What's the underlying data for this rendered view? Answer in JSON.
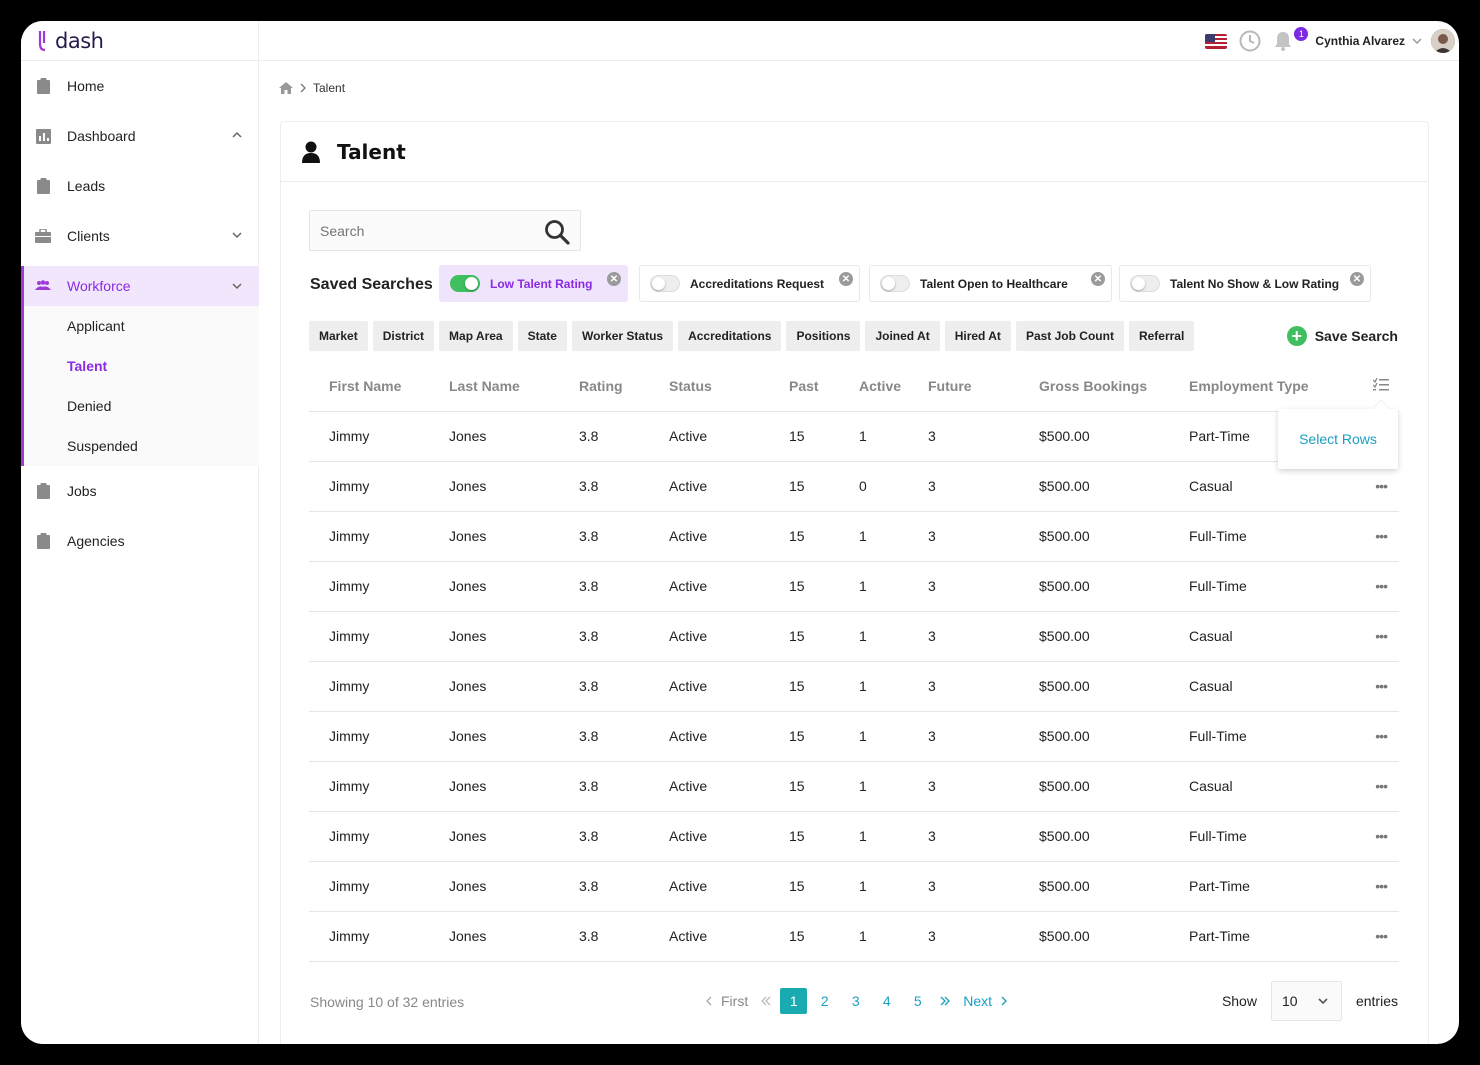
{
  "app": {
    "name": "dash"
  },
  "user": {
    "name": "Cynthia Alvarez",
    "notifications": "1"
  },
  "sidebar": {
    "items": [
      {
        "label": "Home",
        "icon": "clipboard-icon"
      },
      {
        "label": "Dashboard",
        "icon": "chart-icon",
        "expanded": true
      },
      {
        "label": "Leads",
        "icon": "clipboard-icon"
      },
      {
        "label": "Clients",
        "icon": "briefcase-icon",
        "expanded": false
      },
      {
        "label": "Workforce",
        "icon": "users-icon",
        "expanded": true
      },
      {
        "label": "Jobs",
        "icon": "clipboard-icon"
      },
      {
        "label": "Agencies",
        "icon": "clipboard-icon"
      }
    ],
    "workforce_sub": [
      "Applicant",
      "Talent",
      "Denied",
      "Suspended"
    ],
    "active_sub": "Talent"
  },
  "breadcrumb": {
    "current": "Talent"
  },
  "page": {
    "title": "Talent"
  },
  "search": {
    "placeholder": "Search"
  },
  "saved_searches": {
    "label": "Saved Searches",
    "chips": [
      {
        "label": "Low Talent Rating",
        "on": true
      },
      {
        "label": "Accreditations Request",
        "on": false
      },
      {
        "label": "Talent Open to Healthcare",
        "on": false
      },
      {
        "label": "Talent No Show & Low Rating",
        "on": false
      }
    ]
  },
  "filters": [
    "Market",
    "District",
    "Map Area",
    "State",
    "Worker Status",
    "Accreditations",
    "Positions",
    "Joined At",
    "Hired At",
    "Past Job Count",
    "Referral"
  ],
  "save_search_label": "Save Search",
  "table": {
    "columns": [
      "First Name",
      "Last Name",
      "Rating",
      "Status",
      "Past",
      "Active",
      "Future",
      "Gross Bookings",
      "Employment Type"
    ],
    "rows": [
      [
        "Jimmy",
        "Jones",
        "3.8",
        "Active",
        "15",
        "1",
        "3",
        "$500.00",
        "Part-Time"
      ],
      [
        "Jimmy",
        "Jones",
        "3.8",
        "Active",
        "15",
        "0",
        "3",
        "$500.00",
        "Casual"
      ],
      [
        "Jimmy",
        "Jones",
        "3.8",
        "Active",
        "15",
        "1",
        "3",
        "$500.00",
        "Full-Time"
      ],
      [
        "Jimmy",
        "Jones",
        "3.8",
        "Active",
        "15",
        "1",
        "3",
        "$500.00",
        "Full-Time"
      ],
      [
        "Jimmy",
        "Jones",
        "3.8",
        "Active",
        "15",
        "1",
        "3",
        "$500.00",
        "Casual"
      ],
      [
        "Jimmy",
        "Jones",
        "3.8",
        "Active",
        "15",
        "1",
        "3",
        "$500.00",
        "Casual"
      ],
      [
        "Jimmy",
        "Jones",
        "3.8",
        "Active",
        "15",
        "1",
        "3",
        "$500.00",
        "Full-Time"
      ],
      [
        "Jimmy",
        "Jones",
        "3.8",
        "Active",
        "15",
        "1",
        "3",
        "$500.00",
        "Casual"
      ],
      [
        "Jimmy",
        "Jones",
        "3.8",
        "Active",
        "15",
        "1",
        "3",
        "$500.00",
        "Full-Time"
      ],
      [
        "Jimmy",
        "Jones",
        "3.8",
        "Active",
        "15",
        "1",
        "3",
        "$500.00",
        "Part-Time"
      ],
      [
        "Jimmy",
        "Jones",
        "3.8",
        "Active",
        "15",
        "1",
        "3",
        "$500.00",
        "Part-Time"
      ]
    ]
  },
  "popup": {
    "label": "Select Rows"
  },
  "footer": {
    "showing": "Showing 10 of 32 entries",
    "first": "First",
    "next": "Next",
    "pages": [
      "1",
      "2",
      "3",
      "4",
      "5"
    ],
    "current_page": "1",
    "show_label": "Show",
    "entries_value": "10",
    "entries_label": "entries"
  },
  "colors": {
    "accent": "#8a2be2",
    "toggle_on": "#3fbf5f",
    "link": "#1a9fc2",
    "page_active": "#1aabb0"
  }
}
